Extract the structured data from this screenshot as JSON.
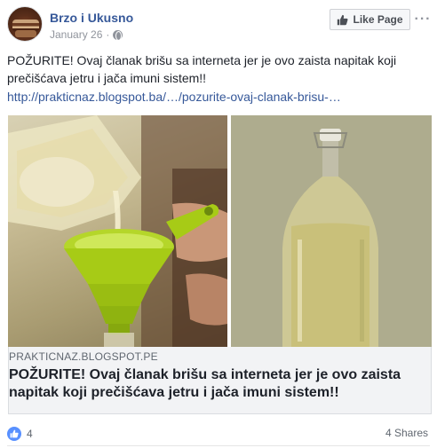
{
  "header": {
    "page_name": "Brzo i Ukusno",
    "date": "January 26",
    "separator": "·",
    "like_page_label": "Like Page",
    "more_label": "···"
  },
  "post": {
    "text": "POŽURITE! Ovaj članak brišu sa interneta jer je ovo zaista napitak koji prečišćava jetru i jača imuni sistem!!",
    "link": "http://prakticnaz.blogspot.ba/…/pozurite-ovaj-clanak-brisu-…"
  },
  "images": {
    "left": "funnel-pouring-icon",
    "right": "bottle-icon"
  },
  "preview": {
    "domain": "PRAKTICNAZ.BLOGSPOT.PE",
    "title": "POŽURITE! Ovaj članak brišu sa interneta jer je ovo zaista napitak koji prečišćava jetru i jača imuni sistem!!"
  },
  "footer": {
    "like_count": "4",
    "shares": "4 Shares"
  },
  "colors": {
    "link": "#365899",
    "like_badge": "#5890ff",
    "funnel": "#b5d62a"
  }
}
